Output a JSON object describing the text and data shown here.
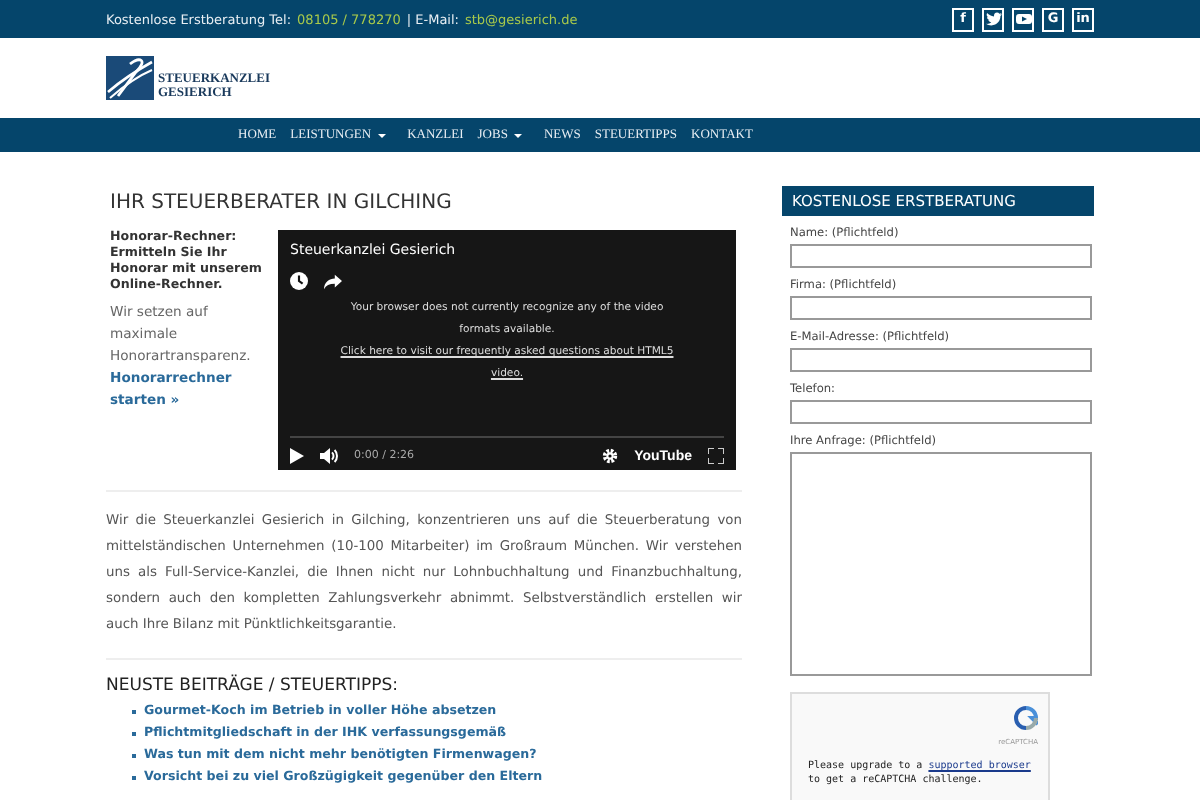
{
  "topbar": {
    "label": "Kostenlose Erstberatung Tel:",
    "phone": "08105 / 778270",
    "separator": "| E-Mail:",
    "email": "stb@gesierich.de",
    "social": [
      {
        "kind": "text",
        "label": "f"
      },
      {
        "kind": "twitter"
      },
      {
        "kind": "youtube"
      },
      {
        "kind": "text",
        "label": "G"
      },
      {
        "kind": "text",
        "label": "in"
      }
    ]
  },
  "logo": {
    "line_1": "STEUERKANZLEI",
    "line_2": "GESIERICH"
  },
  "nav": [
    {
      "label": "HOME",
      "has_dropdown": false
    },
    {
      "label": "LEISTUNGEN",
      "has_dropdown": true
    },
    {
      "label": "KANZLEI",
      "has_dropdown": false
    },
    {
      "label": "JOBS",
      "has_dropdown": true
    },
    {
      "label": "NEWS",
      "has_dropdown": false
    },
    {
      "label": "STEUERTIPPS",
      "has_dropdown": false
    },
    {
      "label": "KONTAKT",
      "has_dropdown": false
    }
  ],
  "main": {
    "title": "IHR STEUERBERATER IN GILCHING",
    "calculator": {
      "heading": "Honorar-Rechner: Ermitteln Sie Ihr Honorar mit unserem Online-Rechner.",
      "text": "Wir setzen auf maximale Honorartransparenz.",
      "link": "Honorarrechner starten »"
    },
    "video": {
      "title": "Steuerkanzlei Gesierich",
      "message": "Your browser does not currently recognize any of the video formats available.",
      "link": "Click here to visit our frequently asked questions about HTML5 video.",
      "time": "0:00 / 2:26",
      "brand": "YouTube"
    },
    "intro": "Wir die Steuerkanzlei Gesierich in Gilching, konzentrieren uns auf die Steuerberatung von mittelständischen Unternehmen (10-100 Mitarbeiter) im Großraum München. Wir verstehen uns als Full-Service-Kanzlei, die Ihnen nicht nur Lohnbuchhaltung und Finanzbuchhaltung, sondern auch den kompletten Zahlungsverkehr abnimmt. Selbstverständlich erstellen wir auch Ihre Bilanz mit Pünktlichkeitsgarantie.",
    "posts_title": "NEUSTE BEITRÄGE / STEUERTIPPS:",
    "posts": [
      "Gourmet-Koch im Betrieb in voller Höhe absetzen",
      "Pflichtmitgliedschaft in der IHK verfassungsgemäß",
      "Was tun mit dem nicht mehr benötigten Firmenwagen?",
      "Vorsicht bei zu viel Großzügigkeit gegenüber den Eltern"
    ]
  },
  "sidebar": {
    "title": "KOSTENLOSE ERSTBERATUNG",
    "fields": [
      {
        "kind": "input",
        "label": "Name: (Pflichtfeld)"
      },
      {
        "kind": "input",
        "label": "Firma: (Pflichtfeld)"
      },
      {
        "kind": "input",
        "label": "E-Mail-Adresse: (Pflichtfeld)"
      },
      {
        "kind": "input",
        "label": "Telefon:"
      },
      {
        "kind": "textarea",
        "label": "Ihre Anfrage: (Pflichtfeld)"
      }
    ],
    "captcha": {
      "brand": "reCAPTCHA",
      "text_before": "Please upgrade to a",
      "link": "supported browser",
      "text_after": "to get a reCAPTCHA challenge."
    }
  }
}
